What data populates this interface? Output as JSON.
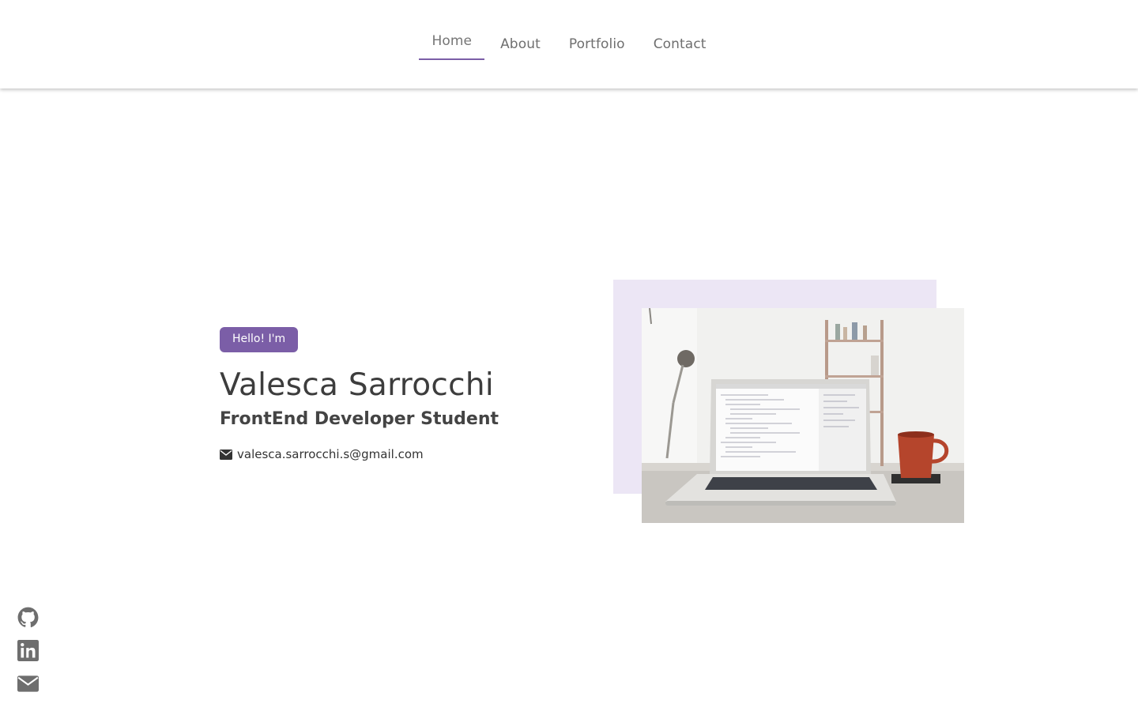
{
  "nav": {
    "items": [
      {
        "label": "Home",
        "active": true
      },
      {
        "label": "About",
        "active": false
      },
      {
        "label": "Portfolio",
        "active": false
      },
      {
        "label": "Contact",
        "active": false
      }
    ]
  },
  "hero": {
    "badge": "Hello! I'm",
    "name": "Valesca Sarrocchi",
    "role": "FrontEnd Developer Student",
    "email": "valesca.sarrocchi.s@gmail.com",
    "email_icon": "envelope-icon"
  },
  "image": {
    "subject": "laptop-with-code-and-coffee-mug-photo"
  },
  "social": {
    "icons": [
      "github-icon",
      "linkedin-icon",
      "envelope-icon"
    ]
  },
  "colors": {
    "accent": "#7b5ea7",
    "accent_light": "#ece6f5",
    "text": "#3b3b3b",
    "icon_gray": "#6e6e6e"
  }
}
